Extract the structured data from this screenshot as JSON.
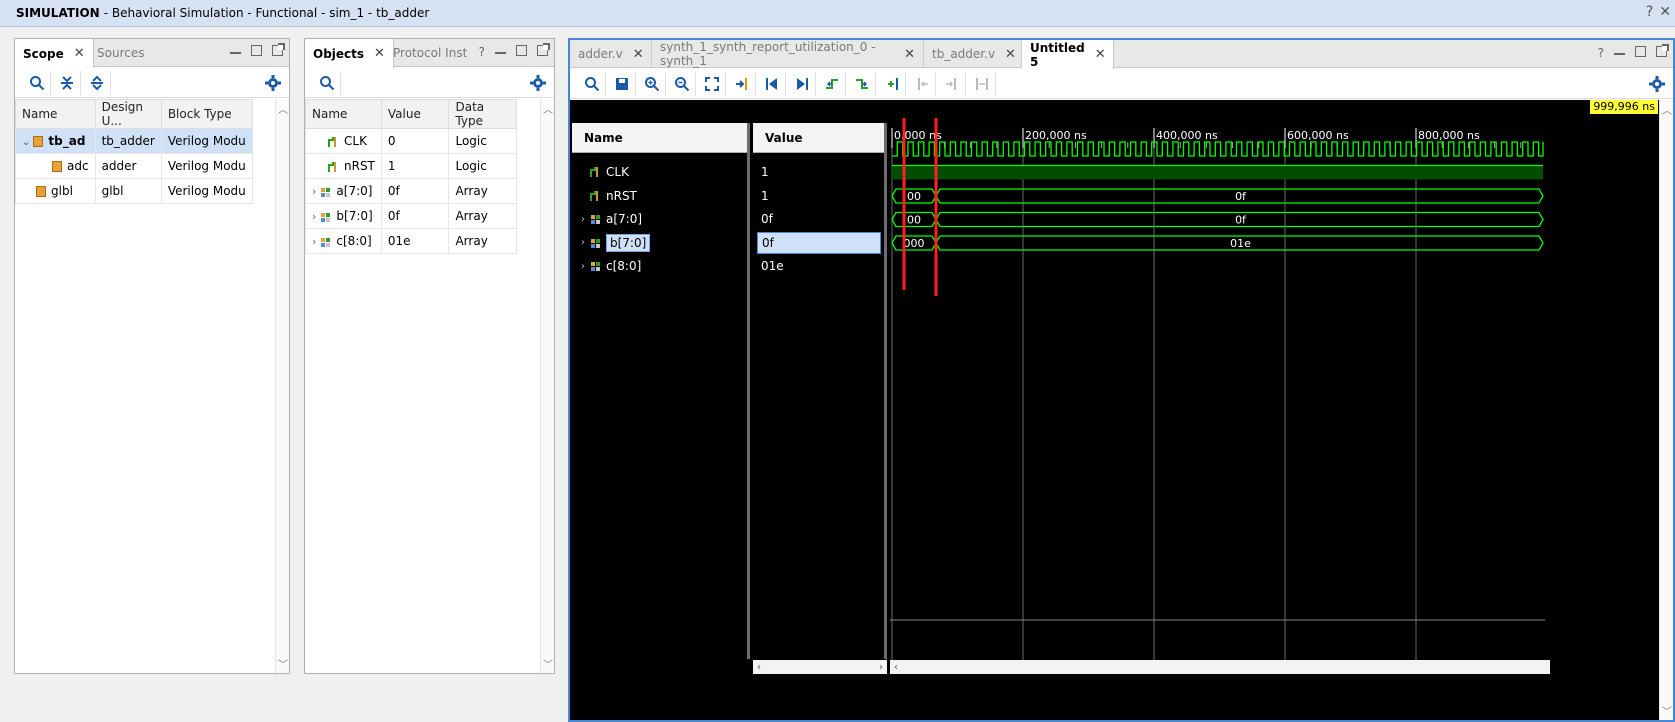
{
  "titlebar": {
    "prefix": "SIMULATION",
    "text": "- Behavioral Simulation - Functional - sim_1 - tb_adder",
    "help": "?",
    "close": "✕"
  },
  "scope_panel": {
    "tabs": [
      {
        "label": "Scope",
        "active": true,
        "closable": true
      },
      {
        "label": "Sources",
        "active": false,
        "closable": false
      }
    ],
    "columns": [
      "Name",
      "Design U...",
      "Block Type"
    ],
    "rows": [
      {
        "name": "tb_ad",
        "design": "tb_adder",
        "block": "Verilog Modu",
        "expanded": true,
        "selected": true,
        "indent": 0
      },
      {
        "name": "adc",
        "design": "adder",
        "block": "Verilog Modu",
        "expanded": false,
        "selected": false,
        "indent": 1
      },
      {
        "name": "glbl",
        "design": "glbl",
        "block": "Verilog Modu",
        "expanded": false,
        "selected": false,
        "indent": 0
      }
    ]
  },
  "objects_panel": {
    "tabs": [
      {
        "label": "Objects",
        "active": true,
        "closable": true
      },
      {
        "label": "Protocol Inst",
        "active": false,
        "closable": false
      }
    ],
    "help": "?",
    "columns": [
      "Name",
      "Value",
      "Data Type"
    ],
    "rows": [
      {
        "name": "CLK",
        "value": "0",
        "type": "Logic",
        "expandable": false
      },
      {
        "name": "nRST",
        "value": "1",
        "type": "Logic",
        "expandable": false
      },
      {
        "name": "a[7:0]",
        "value": "0f",
        "type": "Array",
        "expandable": true
      },
      {
        "name": "b[7:0]",
        "value": "0f",
        "type": "Array",
        "expandable": true
      },
      {
        "name": "c[8:0]",
        "value": "01e",
        "type": "Array",
        "expandable": true
      }
    ]
  },
  "wave_panel": {
    "tabs": [
      {
        "label": "adder.v",
        "active": false
      },
      {
        "label": "synth_1_synth_report_utilization_0 - synth_1",
        "active": false
      },
      {
        "label": "tb_adder.v",
        "active": false
      },
      {
        "label": "Untitled 5",
        "active": true
      }
    ],
    "help": "?",
    "name_header": "Name",
    "value_header": "Value",
    "cursor_time": "999,996 ns",
    "time_ticks": [
      "0.000 ns",
      "200,000 ns",
      "400,000 ns",
      "600,000 ns",
      "800,000 ns"
    ],
    "signals": [
      {
        "name": "CLK",
        "value": "1",
        "kind": "bit",
        "expandable": false,
        "selected": false
      },
      {
        "name": "nRST",
        "value": "1",
        "kind": "bit",
        "expandable": false,
        "selected": false
      },
      {
        "name": "a[7:0]",
        "value": "0f",
        "kind": "bus",
        "expandable": true,
        "selected": false
      },
      {
        "name": "b[7:0]",
        "value": "0f",
        "kind": "bus",
        "expandable": true,
        "selected": true
      },
      {
        "name": "c[8:0]",
        "value": "01e",
        "kind": "bus",
        "expandable": true,
        "selected": false
      }
    ],
    "bus_segments": {
      "a": [
        "00",
        "0f"
      ],
      "b": [
        "00",
        "0f"
      ],
      "c": [
        "000",
        "01e"
      ]
    },
    "colors": {
      "wave": "#00ff00",
      "bus_fill": "#004d00",
      "cursor": "#ff2020",
      "marker_bg": "#ffff33"
    }
  }
}
